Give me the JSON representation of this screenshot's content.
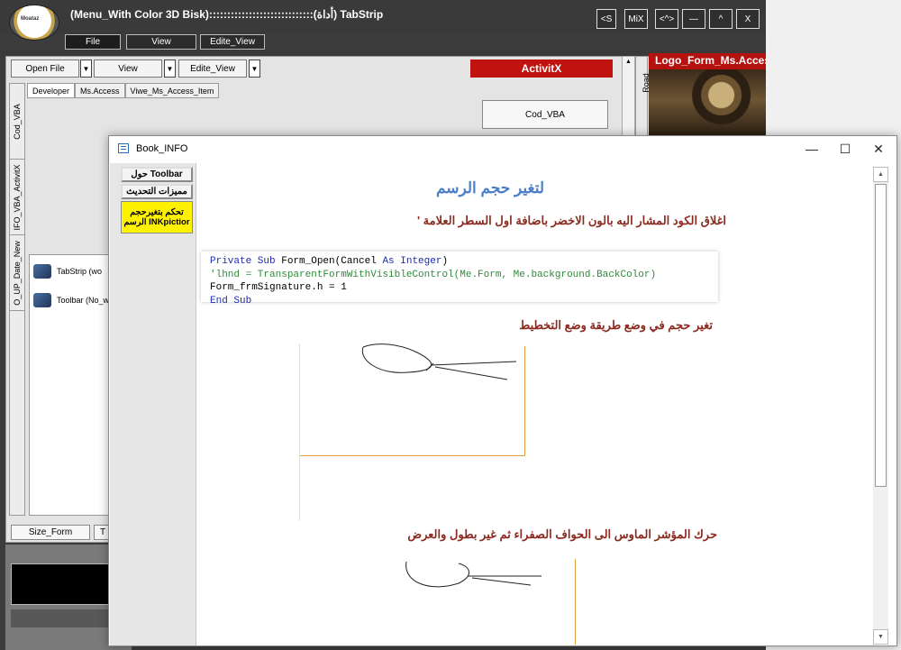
{
  "main_window": {
    "title": "(Menu_With Color 3D Bisk):::::::::::::::::::::::::::::(أداة) TabStrip",
    "logo_text": "Moataz\nذات\nأداة",
    "title_buttons": [
      "<S",
      "MiX",
      "<^>",
      "—",
      "^",
      "X"
    ],
    "menu_tabs": [
      "File",
      "View",
      "Edite_View"
    ],
    "combos": [
      "Open File",
      "View",
      "Edite_View"
    ],
    "activitx_label": "ActivitX",
    "logo_form_label": "Logo_Form_Ms.Access",
    "road_tab": "Road",
    "left_vtabs": [
      "Cod_VBA",
      "IFO_VBA_ActivitX",
      "O_UP_Date_New"
    ],
    "inner_tabs": [
      "Developer",
      "Ms.Access",
      "Viwe_Ms_Access_Item"
    ],
    "cod_vba_button": "Cod_VBA",
    "list_items": [
      "TabStrip (wo",
      "Toolbar (No_w"
    ],
    "size_form_button": "Size_Form",
    "small_button": "T"
  },
  "book_window": {
    "title": "Book_INFO",
    "controls": {
      "minimize": "—",
      "maximize": "☐",
      "close": "✕"
    },
    "sidebar": {
      "toolbar_btn": "حول Toolbar",
      "features_btn": "مميزات التحديث",
      "ink_btn": "تحكم بتغيرحجم الرسم INKpictior"
    },
    "content": {
      "heading": "لتغير حجم الرسم",
      "line1": "اغلاق الكود المشار اليه بالون الاخضر باضافة اول السطر العلامة '",
      "code": {
        "l1_kw1": "Private Sub",
        "l1_rest": " Form_Open(Cancel ",
        "l1_kw2": "As Integer",
        "l1_end": ")",
        "l2": "'lhnd = TransparentFormWithVisibleControl(Me.Form, Me.background.BackColor)",
        "l3": "Form_frmSignature.h = 1",
        "l4": "End Sub"
      },
      "line2": "تغير حجم في وضع طريقة وضع التخطيط",
      "line3": "حرك المؤشر الماوس الى الحواف الصفراء ثم غير بطول والعرض"
    }
  },
  "colors": {
    "activitx_red": "#c0120f",
    "heading_blue": "#4a7fc8",
    "arabic_text": "#8b2a20",
    "ink_yellow": "#fff200"
  },
  "icons": [
    "window-icon",
    "dropdown-arrow-icon",
    "tabstrip-icon",
    "toolbar-icon",
    "scroll-up-icon",
    "scroll-down-icon"
  ]
}
